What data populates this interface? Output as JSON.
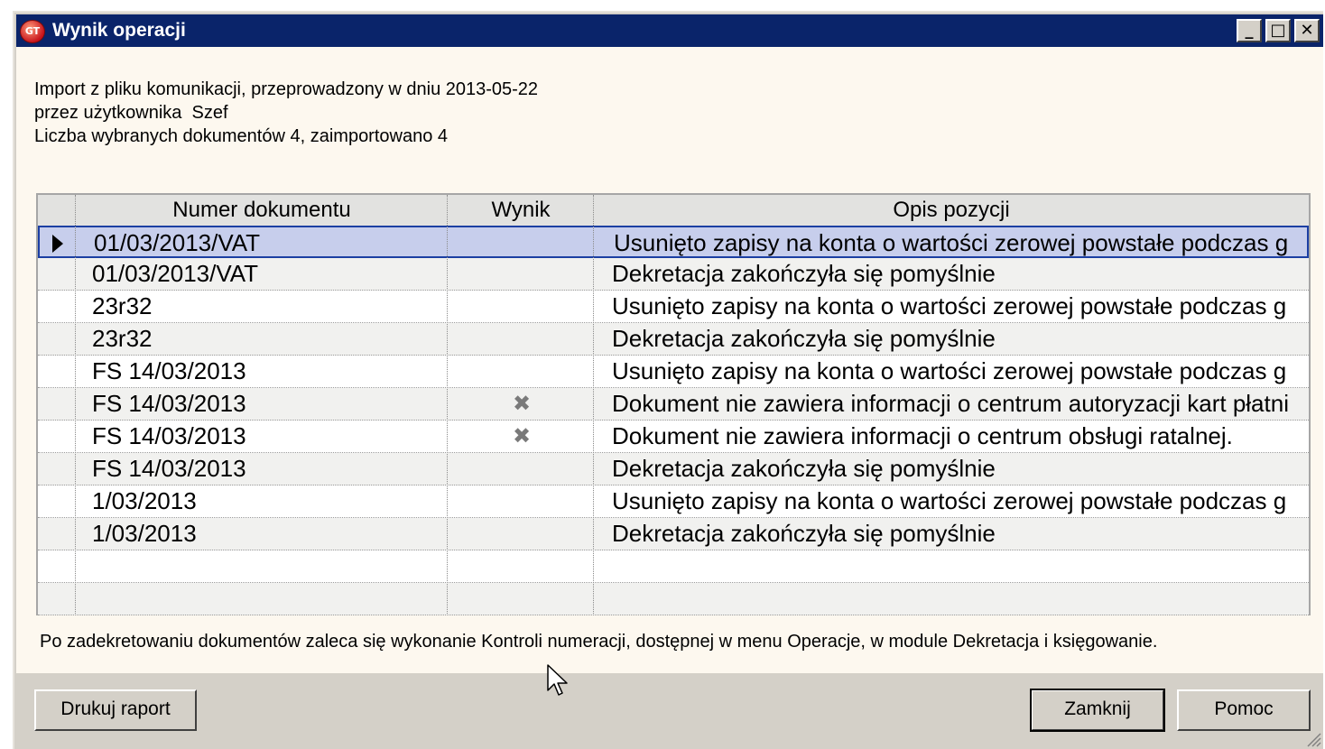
{
  "window": {
    "title": "Wynik operacji",
    "app_icon_text": "GT",
    "buttons": {
      "minimize": "_",
      "maximize": "□",
      "close": "✕"
    }
  },
  "info": {
    "line1": "Import z pliku komunikacji, przeprowadzony w dniu 2013-05-22",
    "line2": "przez użytkownika  Szef",
    "line3": "Liczba wybranych dokumentów 4, zaimportowano 4"
  },
  "grid": {
    "columns": [
      "Numer dokumentu",
      "Wynik",
      "Opis pozycji"
    ],
    "rows": [
      {
        "doc": "01/03/2013/VAT",
        "result": "",
        "desc": "Usunięto zapisy na konta o wartości zerowej powstałe podczas g"
      },
      {
        "doc": "01/03/2013/VAT",
        "result": "",
        "desc": "Dekretacja zakończyła się pomyślnie"
      },
      {
        "doc": "23r32",
        "result": "",
        "desc": "Usunięto zapisy na konta o wartości zerowej powstałe podczas g"
      },
      {
        "doc": "23r32",
        "result": "",
        "desc": "Dekretacja zakończyła się pomyślnie"
      },
      {
        "doc": "FS 14/03/2013",
        "result": "",
        "desc": "Usunięto zapisy na konta o wartości zerowej powstałe podczas g"
      },
      {
        "doc": "FS 14/03/2013",
        "result": "✖",
        "desc": "Dokument nie zawiera informacji o centrum autoryzacji kart płatni"
      },
      {
        "doc": "FS 14/03/2013",
        "result": "✖",
        "desc": "Dokument nie zawiera informacji o centrum obsługi ratalnej."
      },
      {
        "doc": "FS 14/03/2013",
        "result": "",
        "desc": "Dekretacja zakończyła się pomyślnie"
      },
      {
        "doc": "1/03/2013",
        "result": "",
        "desc": "Usunięto zapisy na konta o wartości zerowej powstałe podczas g"
      },
      {
        "doc": "1/03/2013",
        "result": "",
        "desc": "Dekretacja zakończyła się pomyślnie"
      },
      {
        "doc": "",
        "result": "",
        "desc": ""
      },
      {
        "doc": "",
        "result": "",
        "desc": ""
      }
    ],
    "selected_row": 0
  },
  "footnote": "Po zadekretowaniu dokumentów zaleca się wykonanie Kontroli numeracji, dostępnej w menu Operacje, w module Dekretacja i księgowanie.",
  "buttons": {
    "print": "Drukuj raport",
    "close": "Zamknij",
    "help": "Pomoc"
  },
  "icons": {
    "result_error": "x-mark-icon",
    "row_indicator": "triangle-right-icon"
  }
}
